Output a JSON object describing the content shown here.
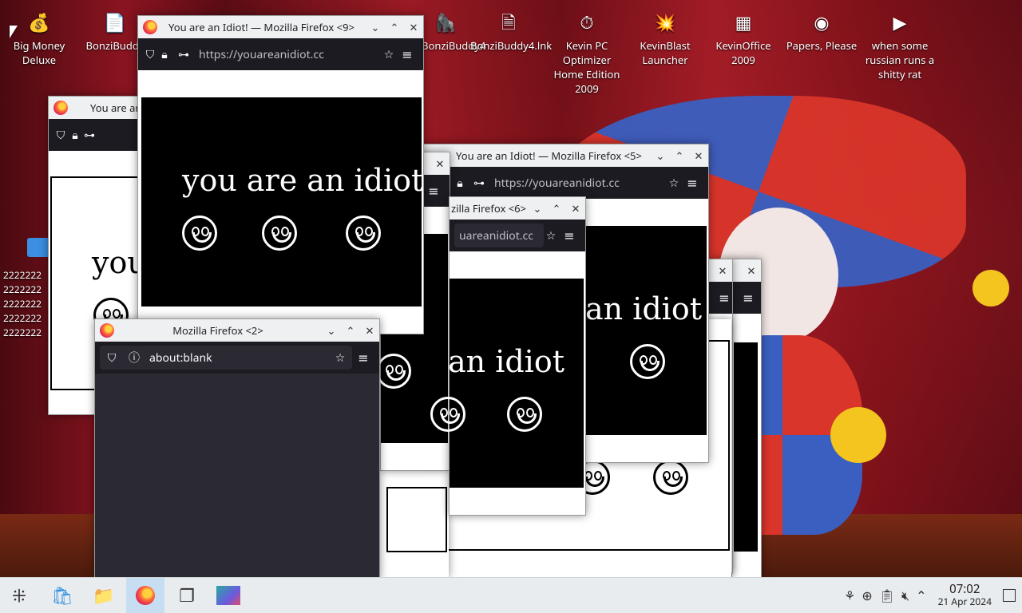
{
  "desktop": {
    "icons": [
      {
        "label": "Big Money Deluxe",
        "icon": "money-bag-icon"
      },
      {
        "label": "BonziBuddy",
        "icon": "folder-icon"
      },
      {
        "label": "BonziBuddy4",
        "icon": "bonzi-icon"
      },
      {
        "label": "BonziBuddy4.lnk",
        "icon": "shortcut-icon"
      },
      {
        "label": "Kevin PC Optimizer Home Edition 2009",
        "icon": "optimizer-icon"
      },
      {
        "label": "KevinBlast Launcher",
        "icon": "blast-icon"
      },
      {
        "label": "KevinOffice 2009",
        "icon": "office-icon"
      },
      {
        "label": "Papers, Please",
        "icon": "papers-icon"
      },
      {
        "label": "when some russian runs a shitty rat",
        "icon": "video-icon"
      }
    ],
    "side_folder_lines": [
      "2222222",
      "2222222",
      "2222222",
      "2222222",
      "2222222"
    ]
  },
  "windows": {
    "w9": {
      "title": "You are an Idiot! — Mozilla Firefox <9>",
      "url": "https://youareanidiot.cc",
      "text": "you are an idiot"
    },
    "w5": {
      "title": "You are an Idiot! — Mozilla Firefox <5>",
      "url": "https://youareanidiot.cc",
      "text": "an idiot"
    },
    "w6": {
      "title": "zilla Firefox <6>",
      "url": "uareanidiot.cc",
      "text": "an idiot"
    },
    "w_left": {
      "title": "You are an",
      "text": "you"
    },
    "w2": {
      "title": "Mozilla Firefox <2>",
      "url": "about:blank"
    }
  },
  "taskbar": {
    "clock_time": "07:02",
    "clock_date": "21 Apr 2024"
  }
}
